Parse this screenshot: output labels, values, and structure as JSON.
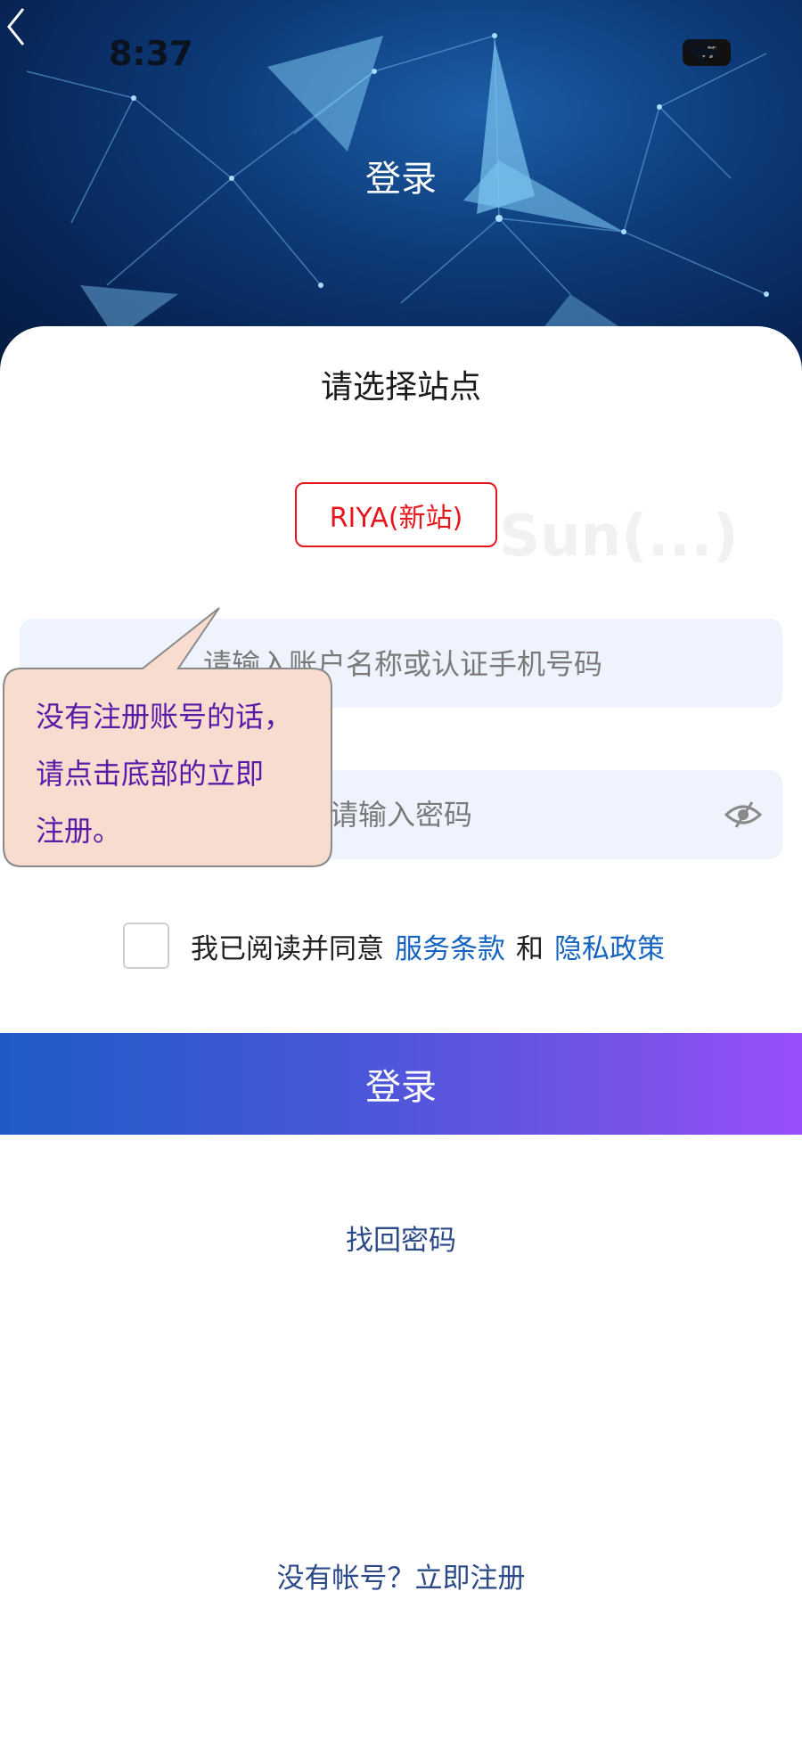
{
  "status_bar": {
    "time": "8:37",
    "battery": "37"
  },
  "nav": {
    "title": "登录",
    "back_icon": "chevron-left-icon"
  },
  "site": {
    "heading": "请选择站点",
    "selected": "RIYA(新站)",
    "ghost_option": "Sun(...)"
  },
  "form": {
    "account_placeholder": "请输入账户名称或认证手机号码",
    "password_placeholder": "请输入密码",
    "eye_icon": "eye-slash-icon"
  },
  "agreement": {
    "prefix": "我已阅读并同意",
    "terms": "服务条款",
    "and": "和",
    "privacy": "隐私政策"
  },
  "login_button": "登录",
  "forgot_password": "找回密码",
  "register_link": "没有帐号？立即注册",
  "tooltip": {
    "lines": [
      "没有注册账号的话，",
      "请点击底部的立即",
      "注册。"
    ]
  },
  "colors": {
    "accent_red": "#e6161b",
    "link_blue": "#1565c0",
    "gradient_start": "#1e5bc6",
    "gradient_end": "#9a4efc",
    "tooltip_bg": "#f7dccf",
    "tooltip_text": "#5a1aa8"
  }
}
